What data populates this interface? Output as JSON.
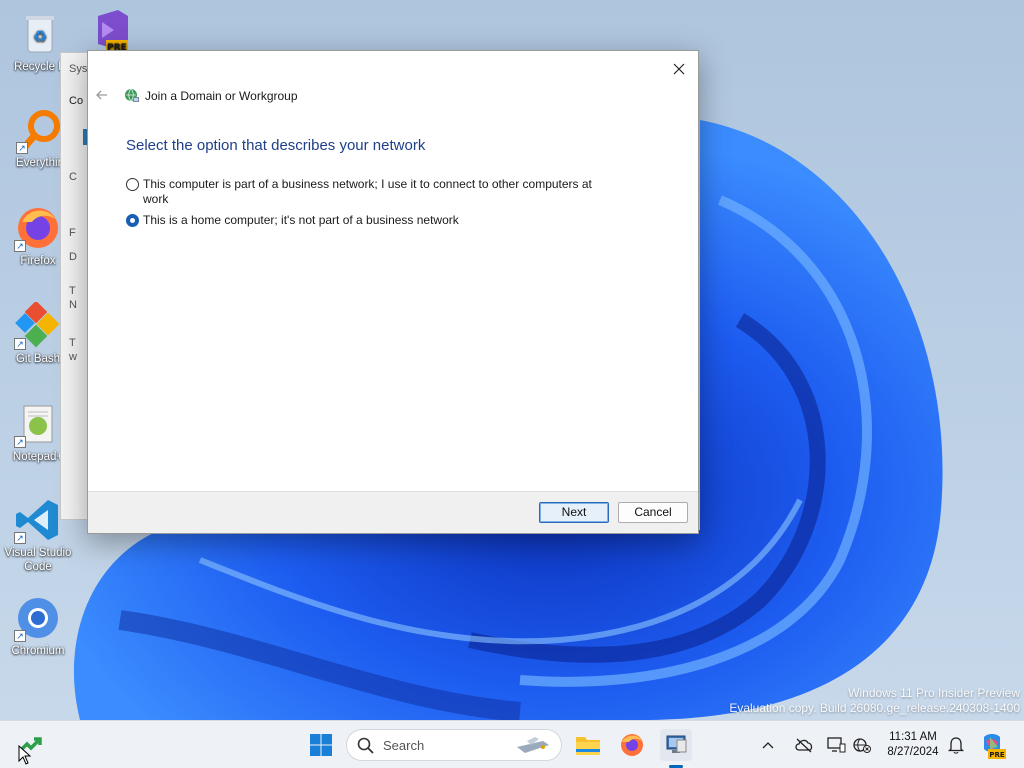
{
  "desktop": {
    "icons": [
      {
        "label": "Recycle Bin",
        "display": "Recycle B",
        "icon": "recycle-bin-icon"
      },
      {
        "label": "PRE",
        "icon": "visual-studio-preview-icon"
      },
      {
        "label": "Everything",
        "display": "Everythin",
        "icon": "everything-search-icon"
      },
      {
        "label": "Firefox",
        "icon": "firefox-icon"
      },
      {
        "label": "Git Bash",
        "icon": "git-bash-icon"
      },
      {
        "label": "Notepad++",
        "display": "Notepad+",
        "icon": "notepad-plus-plus-icon"
      },
      {
        "label": "Visual Studio Code",
        "line1": "Visual Studio",
        "line2": "Code",
        "icon": "vscode-icon"
      },
      {
        "label": "Chromium",
        "icon": "chromium-icon"
      }
    ]
  },
  "background_window": {
    "title": "Sys",
    "tab": "Co",
    "fragments": [
      "C",
      "F",
      "D",
      "T",
      "N",
      "T",
      "w"
    ]
  },
  "dialog": {
    "title": "Join a Domain or Workgroup",
    "heading": "Select the option that describes your network",
    "options": [
      {
        "label_line1": "This computer is part of a business network; I use it to connect to other computers at",
        "label_line2": "work",
        "selected": false
      },
      {
        "label_line1": "This is a home computer; it's not part of a business network",
        "selected": true
      }
    ],
    "buttons": {
      "next": "Next",
      "cancel": "Cancel"
    }
  },
  "watermark": {
    "line1": "Windows 11 Pro Insider Preview",
    "line2": "Evaluation copy. Build 26080.ge_release.240308-1400"
  },
  "taskbar": {
    "search_placeholder": "Search",
    "time": "11:31 AM",
    "date": "8/27/2024",
    "badge": "PRE",
    "accent": "#0067c0"
  }
}
